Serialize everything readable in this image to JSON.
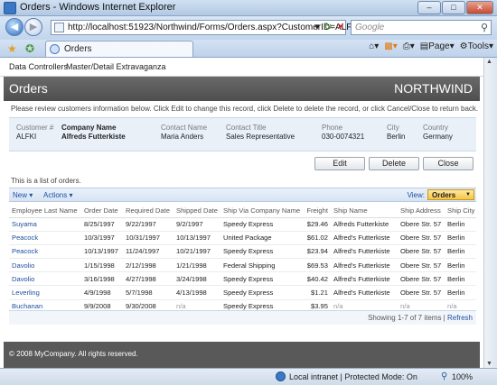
{
  "window": {
    "title": "Orders - Windows Internet Explorer"
  },
  "address": {
    "url": "http://localhost:51923/Northwind/Forms/Orders.aspx?CustomerID=ALFKI",
    "search_placeholder": "Google"
  },
  "tab": {
    "label": "Orders"
  },
  "toolbar": {
    "page_label": "Page",
    "tools_label": "Tools"
  },
  "menu": {
    "items": [
      "Data Controllers",
      "Master/Detail Extravaganza"
    ]
  },
  "header": {
    "title": "Orders",
    "brand": "NORTHWIND"
  },
  "description": "This is a list of orders.",
  "instructions": "Please review customers information below. Click Edit to change this record, click Delete to delete the record, or click Cancel/Close to return back.",
  "customer": [
    {
      "label": "Customer #",
      "value": "ALFKI"
    },
    {
      "label": "Company Name",
      "value": "Alfreds Futterkiste"
    },
    {
      "label": "Contact Name",
      "value": "Maria Anders"
    },
    {
      "label": "Contact Title",
      "value": "Sales Representative"
    },
    {
      "label": "Phone",
      "value": "030-0074321"
    },
    {
      "label": "City",
      "value": "Berlin"
    },
    {
      "label": "Country",
      "value": "Germany"
    }
  ],
  "actions": {
    "edit": "Edit",
    "delete": "Delete",
    "close": "Close"
  },
  "gridbar": {
    "new": "New ▾",
    "actions": "Actions ▾",
    "view_label": "View:",
    "view_value": "Orders"
  },
  "columns": [
    "Employee Last Name",
    "Order Date",
    "Required Date",
    "Shipped Date",
    "Ship Via Company Name",
    "Freight",
    "Ship Name",
    "Ship Address",
    "Ship City"
  ],
  "rows": [
    [
      "Suyama",
      "8/25/1997",
      "9/22/1997",
      "9/2/1997",
      "Speedy Express",
      "$29.46",
      "Alfreds Futterkiste",
      "Obere Str. 57",
      "Berlin"
    ],
    [
      "Peacock",
      "10/3/1997",
      "10/31/1997",
      "10/13/1997",
      "United Package",
      "$61.02",
      "Alfred's Futterkiste",
      "Obere Str. 57",
      "Berlin"
    ],
    [
      "Peacock",
      "10/13/1997",
      "11/24/1997",
      "10/21/1997",
      "Speedy Express",
      "$23.94",
      "Alfred's Futterkiste",
      "Obere Str. 57",
      "Berlin"
    ],
    [
      "Davolio",
      "1/15/1998",
      "2/12/1998",
      "1/21/1998",
      "Federal Shipping",
      "$69.53",
      "Alfred's Futterkiste",
      "Obere Str. 57",
      "Berlin"
    ],
    [
      "Davolio",
      "3/16/1998",
      "4/27/1998",
      "3/24/1998",
      "Speedy Express",
      "$40.42",
      "Alfred's Futterkiste",
      "Obere Str. 57",
      "Berlin"
    ],
    [
      "Leverling",
      "4/9/1998",
      "5/7/1998",
      "4/13/1998",
      "Speedy Express",
      "$1.21",
      "Alfred's Futterkiste",
      "Obere Str. 57",
      "Berlin"
    ],
    [
      "Buchanan",
      "9/9/2008",
      "9/30/2008",
      "n/a",
      "Speedy Express",
      "$3.95",
      "n/a",
      "n/a",
      "n/a"
    ]
  ],
  "pager": {
    "text": "Showing 1-7 of 7 items |",
    "refresh": "Refresh"
  },
  "footer": {
    "text": "© 2008 MyCompany. All rights reserved."
  },
  "status": {
    "zone": "Local intranet | Protected Mode: On",
    "zoom": "100%"
  }
}
